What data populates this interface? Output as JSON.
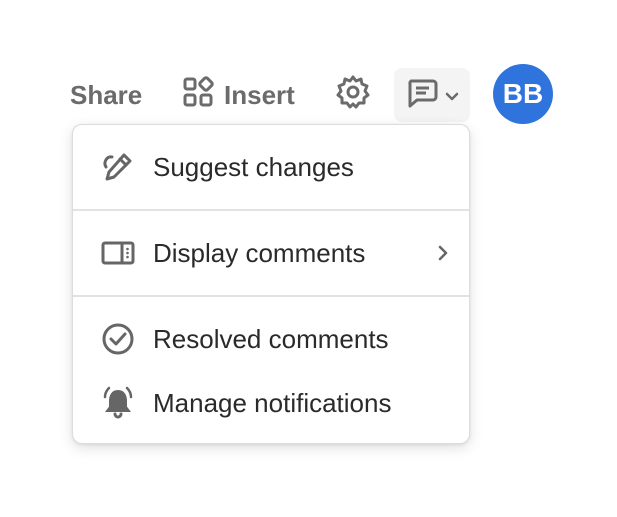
{
  "toolbar": {
    "share_label": "Share",
    "insert_label": "Insert",
    "avatar_initials": "BB",
    "avatar_color": "#2f74dd",
    "icons": {
      "insert": "grid-shapes-icon",
      "settings": "gear-icon",
      "comments": "comment-icon",
      "comments_dropdown": "chevron-down-icon"
    }
  },
  "menu": {
    "items": [
      {
        "label": "Suggest changes",
        "icon": "pencil-paperclip-icon"
      },
      {
        "label": "Display comments",
        "icon": "sidebar-panel-icon",
        "has_submenu": true
      },
      {
        "label": "Resolved comments",
        "icon": "check-circle-icon"
      },
      {
        "label": "Manage notifications",
        "icon": "bell-icon"
      }
    ]
  }
}
